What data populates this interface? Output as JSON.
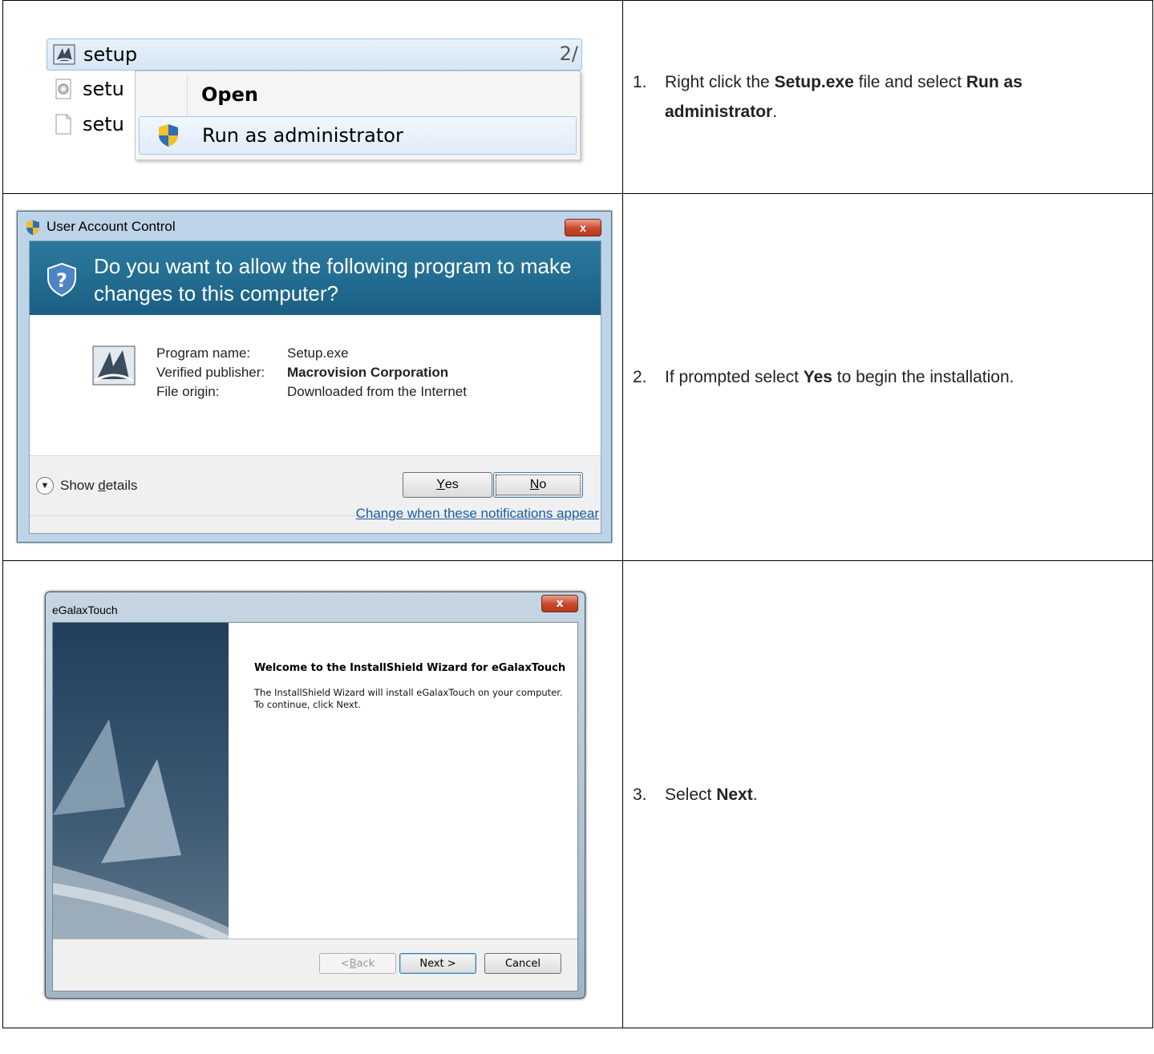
{
  "rows": [
    {
      "step_number": "1.",
      "parts": [
        "Right click the ",
        "Setup.exe",
        " file and select ",
        "Run as administrator",
        "."
      ],
      "context_menu": {
        "files": [
          "setup",
          "setu",
          "setu"
        ],
        "age": "2/",
        "items": [
          "Open",
          "Run as administrator"
        ]
      }
    },
    {
      "step_number": "2.",
      "parts": [
        "If prompted select ",
        "Yes",
        " to begin the installation."
      ],
      "uac": {
        "title": "User Account Control",
        "question": "Do you want to allow the following program to make changes to this computer?",
        "fields": [
          {
            "label": "Program name:",
            "value": "Setup.exe"
          },
          {
            "label": "Verified publisher:",
            "value": "Macrovision Corporation"
          },
          {
            "label": "File origin:",
            "value": "Downloaded from the Internet"
          }
        ],
        "details_label_pre": "Show ",
        "details_label_key": "d",
        "details_label_post": "etails",
        "yes_key": "Y",
        "yes_rest": "es",
        "no_key": "N",
        "no_rest": "o",
        "link": "Change when these notifications appear",
        "close": "x"
      }
    },
    {
      "step_number": "3.",
      "parts": [
        "Select ",
        "Next",
        "."
      ],
      "installer": {
        "title": "eGalaxTouch",
        "heading": "Welcome to the InstallShield Wizard for eGalaxTouch",
        "body": "The InstallShield Wizard will install eGalaxTouch on your computer.  To continue, click Next.",
        "back_pre": "< ",
        "back_key": "B",
        "back_rest": "ack",
        "next": "Next >",
        "cancel": "Cancel",
        "close": "x"
      }
    }
  ],
  "colors": {
    "uac_banner": "#1a5f83",
    "link": "#1a5fa6",
    "close_button": "#c9472a",
    "wizard_art": "#3d5a73"
  }
}
